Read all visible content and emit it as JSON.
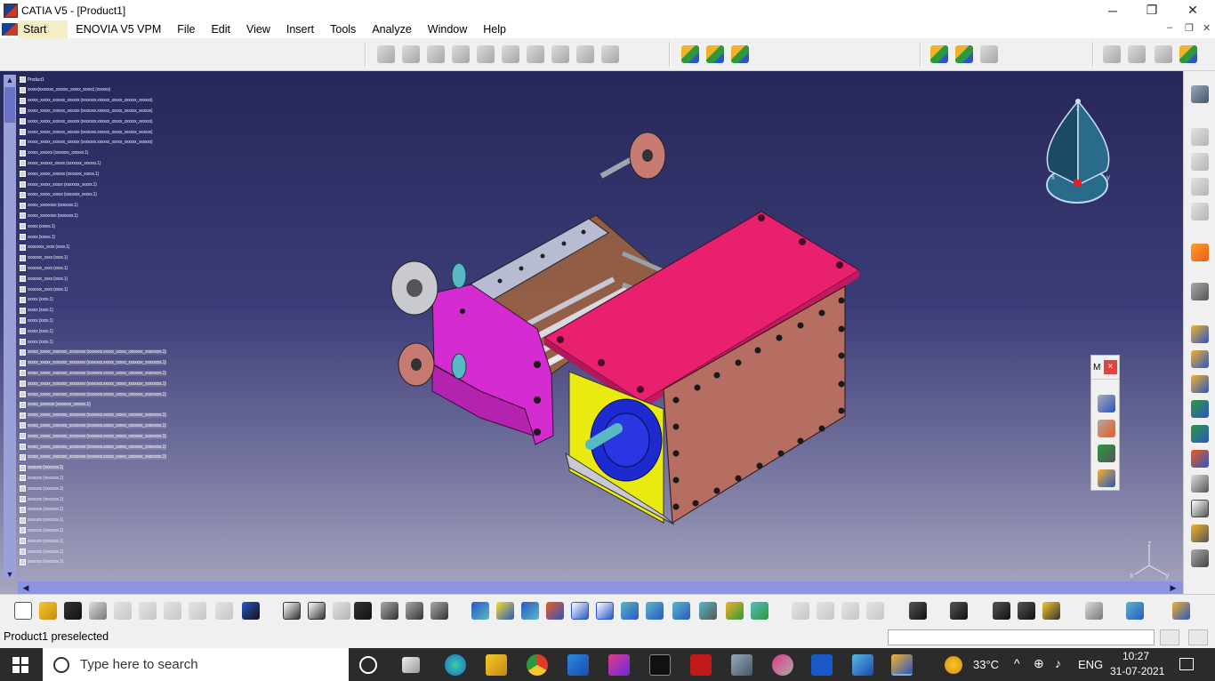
{
  "window": {
    "title": "CATIA V5 - [Product1]",
    "minimize": "─",
    "restore": "❐",
    "close": "✕"
  },
  "menubar": {
    "items": [
      "Start",
      "ENOVIA V5 VPM",
      "File",
      "Edit",
      "View",
      "Insert",
      "Tools",
      "Analyze",
      "Window",
      "Help"
    ]
  },
  "mdi": {
    "minimize": "–",
    "restore": "❐",
    "close": "✕"
  },
  "spec_tree": {
    "root_label": "Product1",
    "rows": [
      "xxxxx(xxxxxxx_xxxxxx_xxxxx_xxxxx) (xxxxxx)",
      "xxxxx_xxxxx_xxxxxx_xxxxxx (xxxxxxx.xxxxxx_xxxxx_xxxxxx_xxxxxx)",
      "xxxxx_xxxxx_xxxxxx_xxxxxx (xxxxxxx.xxxxxx_xxxxx_xxxxxx_xxxxxx)",
      "xxxxx_xxxxx_xxxxxx_xxxxxx (xxxxxxx.xxxxxx_xxxxx_xxxxxx_xxxxxx)",
      "xxxxx_xxxxx_xxxxxx_xxxxxx (xxxxxxx.xxxxxx_xxxxx_xxxxxx_xxxxxx)",
      "xxxxx_xxxxx_xxxxxx_xxxxxx (xxxxxxx.xxxxxx_xxxxx_xxxxxx_xxxxxx)",
      "xxxxx_xxxxxx (xxxxxxx_xxxxxx.1)",
      "xxxxx_xxxxxx_xxxxx (xxxxxxx_xxxxxx.1)",
      "xxxxx_xxxxx_xxxxxx (xxxxxxx_xxxxx.1)",
      "xxxxx_xxxxx_xxxxx (xxxxxxx_xxxxx.1)",
      "xxxxx_xxxxx_xxxxx (xxxxxxx_xxxxx.1)",
      "xxxxx_xxxxxxxx (xxxxxxx.1)",
      "xxxxx_xxxxxxxx (xxxxxxx.1)",
      "xxxxx (xxxxx.1)",
      "xxxxx (xxxxx.1)",
      "xxxxxxxx_xxxx (xxxx.1)",
      "xxxxxxx_xxxx (xxxx.1)",
      "xxxxxxx_xxxx (xxxx.1)",
      "xxxxxxx_xxxx (xxxx.1)",
      "xxxxxxx_xxxx (xxxx.1)",
      "xxxxx (xxxx.1)",
      "xxxxx (xxxx.1)",
      "xxxxx (xxxx.1)",
      "xxxxx (xxxx.1)",
      "xxxxx (xxxx.1)",
      "xxxxx_xxxxx_xxxxxxx_xxxxxxxx (xxxxxxx.xxxxx_xxxxx_xxxxxxx_xxxxxxxx.1)",
      "xxxxx_xxxxx_xxxxxxx_xxxxxxxx (xxxxxxx.xxxxx_xxxxx_xxxxxxx_xxxxxxxx.1)",
      "xxxxx_xxxxx_xxxxxxx_xxxxxxxx (xxxxxxx.xxxxx_xxxxx_xxxxxxx_xxxxxxxx.1)",
      "xxxxx_xxxxx_xxxxxxx_xxxxxxxx (xxxxxxx.xxxxx_xxxxx_xxxxxxx_xxxxxxxx.1)",
      "xxxxx_xxxxx_xxxxxxx_xxxxxxxx (xxxxxxx.xxxxx_xxxxx_xxxxxxx_xxxxxxxx.1)",
      "xxxxx_xxxxxxx (xxxxxxx_xxxxxx.1)",
      "xxxxx_xxxxx_xxxxxxx_xxxxxxxx (xxxxxxx.xxxxx_xxxxx_xxxxxxx_xxxxxxxx.1)",
      "xxxxx_xxxxx_xxxxxxx_xxxxxxxx (xxxxxxx.xxxxx_xxxxx_xxxxxxx_xxxxxxxx.1)",
      "xxxxx_xxxxx_xxxxxxx_xxxxxxxx (xxxxxxx.xxxxx_xxxxx_xxxxxxx_xxxxxxxx.1)",
      "xxxxx_xxxxx_xxxxxxx_xxxxxxxx (xxxxxxx.xxxxx_xxxxx_xxxxxxx_xxxxxxxx.1)",
      "xxxxx_xxxxx_xxxxxxx_xxxxxxxx (xxxxxxx.xxxxx_xxxxx_xxxxxxx_xxxxxxxx.1)",
      "xxxxxxx (xxxxxxx.1)",
      "xxxxxxx (xxxxxxx.1)",
      "xxxxxxx (xxxxxxx.1)",
      "xxxxxxx (xxxxxxx.1)",
      "xxxxxxx (xxxxxxx.1)",
      "xxxxxxx (xxxxxxx.1)",
      "xxxxxxx (xxxxxxx.1)",
      "xxxxxxx (xxxxxxx.1)",
      "xxxxxxx (xxxxxxx.1)",
      "xxxxxxx (xxxxxxx.1)"
    ]
  },
  "compass": {
    "x_label": "x",
    "y_label": "y",
    "z_label": "z"
  },
  "axes_triad": {
    "x_label": "x",
    "y_label": "y",
    "z_label": "z"
  },
  "floating_toolbar": {
    "title": "M",
    "close": "×"
  },
  "status": {
    "message": "Product1 preselected",
    "command_value": ""
  },
  "taskbar": {
    "search_placeholder": "Type here to search",
    "temperature": "33°C",
    "language": "ENG",
    "time": "10:27",
    "date": "31-07-2021"
  },
  "colors": {
    "viewport_top": "#27275b",
    "viewport_bottom": "#a6a6c0",
    "start_highlight": "#f5edc4",
    "plate_magenta": "#e8206e",
    "housing_brown": "#b66d62",
    "face_yellow": "#e8ea10",
    "flange_blue": "#1c2ad0"
  }
}
